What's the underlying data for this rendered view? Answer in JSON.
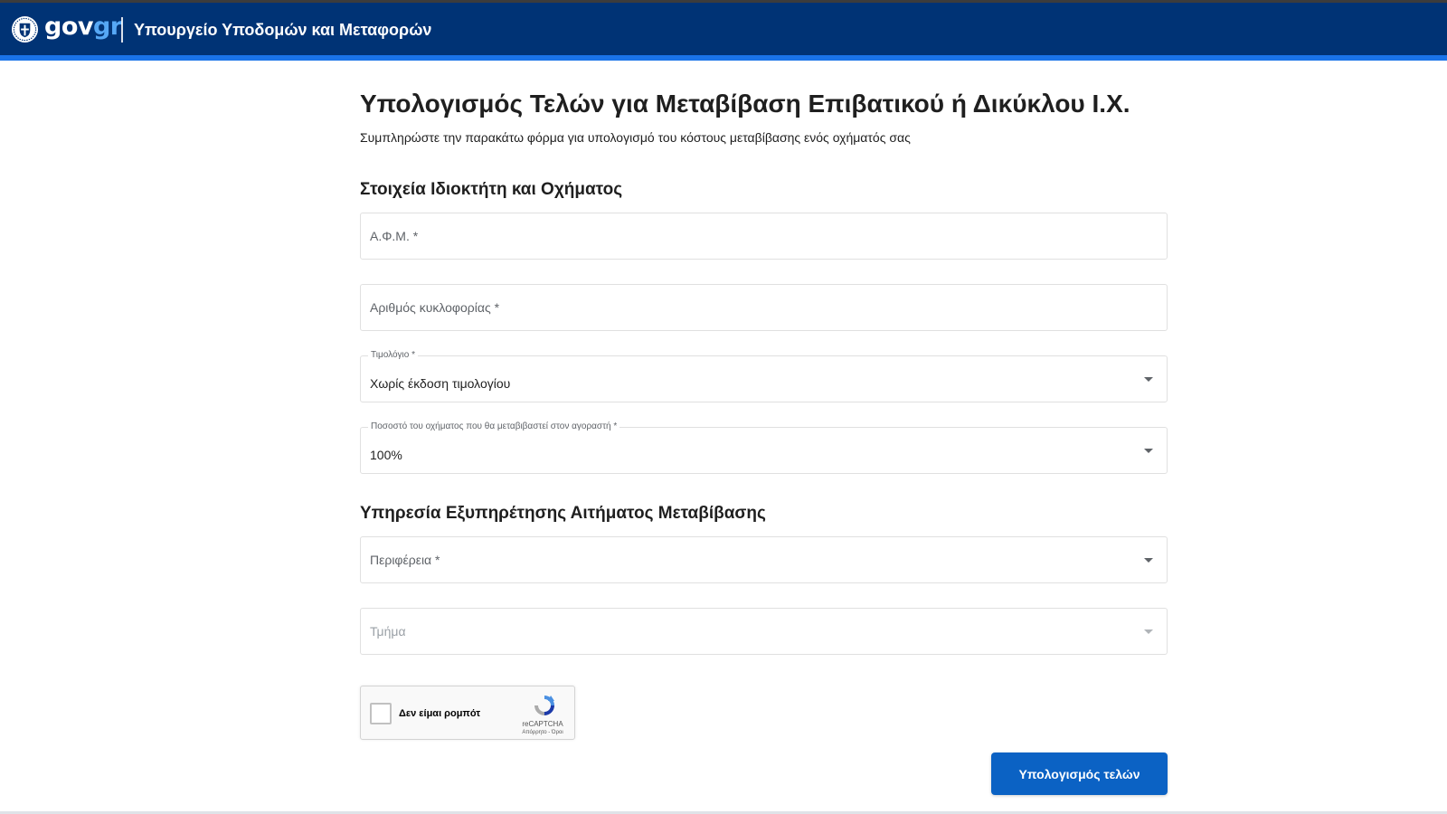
{
  "header": {
    "logo_gov": "gov",
    "logo_gr": "gr",
    "ministry": "Υπουργείο Υποδομών και Μεταφορών",
    "emblem_icon": "greek-coat-of-arms-icon",
    "background_color": "#003375",
    "accent_color": "#1a73e8"
  },
  "page": {
    "title": "Υπολογισμός Τελών για Μεταβίβαση Επιβατικού ή Δικύκλου Ι.Χ.",
    "subtitle": "Συμπληρώστε την παρακάτω φόρμα για υπολογισμό του κόστους μεταβίβασης ενός οχήματός σας"
  },
  "section_owner": {
    "title": "Στοιχεία Ιδιοκτήτη και Οχήματος",
    "afm": {
      "placeholder": "Α.Φ.Μ. *",
      "value": ""
    },
    "plate": {
      "placeholder": "Αριθμός κυκλοφορίας *",
      "value": ""
    },
    "invoice": {
      "label": "Τιμολόγιο *",
      "value": "Χωρίς έκδοση τιμολογίου"
    },
    "percentage": {
      "label": "Ποσοστό του οχήματος που θα μεταβιβαστεί στον αγοραστή *",
      "value": "100%"
    }
  },
  "section_service": {
    "title": "Υπηρεσία Εξυπηρέτησης Αιτήματος Μεταβίβασης",
    "region": {
      "placeholder": "Περιφέρεια *",
      "value": ""
    },
    "department": {
      "placeholder": "Τμήμα",
      "value": "",
      "disabled": true
    }
  },
  "recaptcha": {
    "label": "Δεν είμαι ρομπότ",
    "brand": "reCAPTCHA",
    "terms": "Απόρρητο - Όροι",
    "logo_icon": "recaptcha-icon"
  },
  "actions": {
    "submit_label": "Υπολογισμός τελών",
    "submit_color": "#0b62c4"
  }
}
